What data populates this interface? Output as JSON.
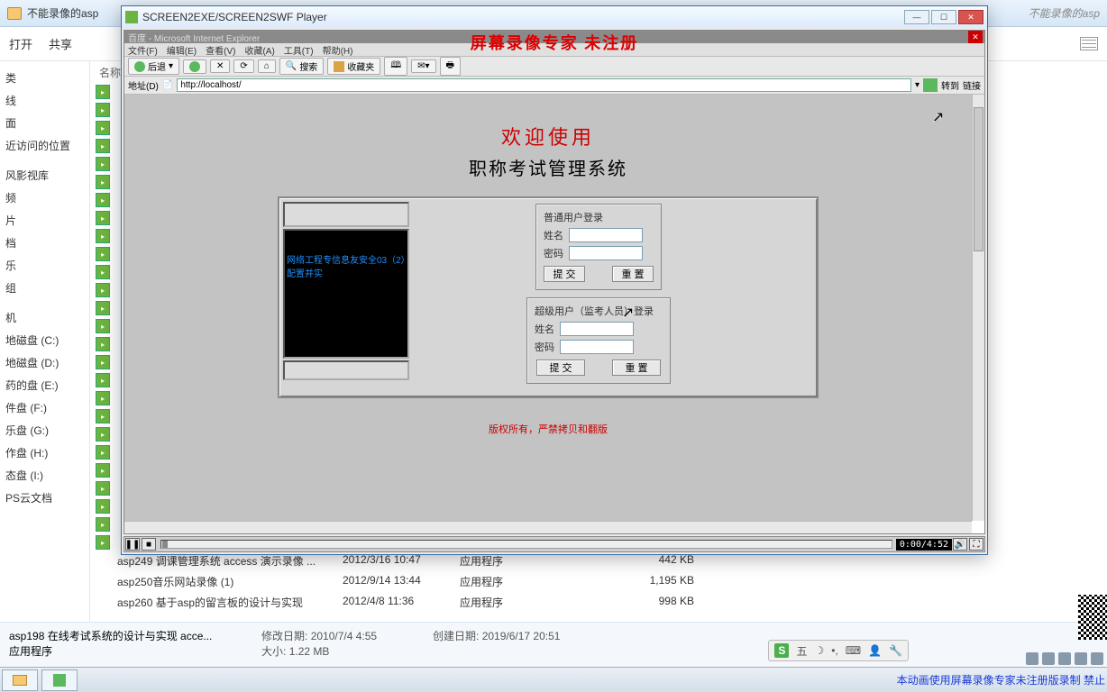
{
  "explorer": {
    "path_title": "不能录像的asp",
    "ghost_path": "不能录像的asp",
    "toolbar": {
      "open": "打开",
      "share": "共享"
    },
    "col_name": "名称",
    "side_items": [
      "类",
      "线",
      "面",
      "近访问的位置",
      "",
      "风影视库",
      "频",
      "片",
      "档",
      "乐",
      "组",
      "",
      "机",
      "地磁盘 (C:)",
      "地磁盘 (D:)",
      "药的盘 (E:)",
      "件盘 (F:)",
      "乐盘 (G:)",
      "作盘 (H:)",
      "态盘 (I:)",
      "PS云文档"
    ],
    "rows": [
      {
        "name": "asp249 调课管理系统 access 演示录像 ...",
        "date": "2012/3/16 10:47",
        "type": "应用程序",
        "size": "442 KB"
      },
      {
        "name": "asp250音乐网站录像 (1)",
        "date": "2012/9/14 13:44",
        "type": "应用程序",
        "size": "1,195 KB"
      },
      {
        "name": "asp260 基于asp的留言板的设计与实现",
        "date": "2012/4/8 11:36",
        "type": "应用程序",
        "size": "998 KB"
      }
    ],
    "details": {
      "file": "asp198 在线考试系统的设计与实现 acce...",
      "type": "应用程序",
      "mod_label": "修改日期:",
      "mod": "2010/7/4 4:55",
      "create_label": "创建日期:",
      "create": "2019/6/17 20:51",
      "size_label": "大小:",
      "size": "1.22 MB"
    }
  },
  "player": {
    "title": "SCREEN2EXE/SCREEN2SWF Player",
    "time": "0:00/4:52"
  },
  "ie": {
    "title": "百度 - Microsoft Internet Explorer",
    "menu": [
      "文件(F)",
      "编辑(E)",
      "查看(V)",
      "收藏(A)",
      "工具(T)",
      "帮助(H)"
    ],
    "back": "后退",
    "search": "搜索",
    "fav": "收藏夹",
    "addr_label": "地址(D)",
    "url": "http://localhost/",
    "go": "转到",
    "links": "链接",
    "watermark": "屏幕录像专家  未注册"
  },
  "page": {
    "welcome": "欢迎使用",
    "system": "职称考试管理系统",
    "video_text": "网络工程专信息友安全03（2）配置并实",
    "form1": {
      "legend": "普通用户登录",
      "name": "姓名",
      "pwd": "密码",
      "submit": "提  交",
      "reset": "重  置"
    },
    "form2": {
      "legend": "超级用户（监考人员）登录",
      "name": "姓名",
      "pwd": "密码",
      "submit": "提  交",
      "reset": "重  置"
    },
    "copyright": "版权所有，严禁拷贝和翻版"
  },
  "ime": {
    "label": "五"
  },
  "taskbar": {
    "watermark": "本动画使用屏幕录像专家未注册版录制 禁止"
  }
}
